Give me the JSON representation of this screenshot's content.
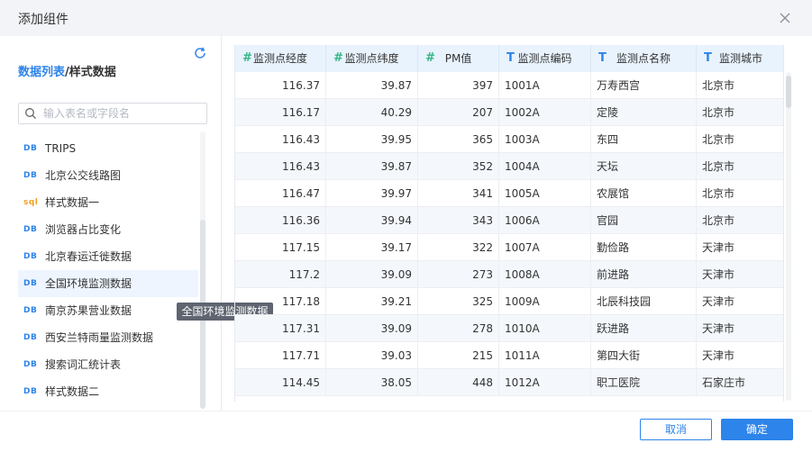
{
  "dialog": {
    "title": "添加组件",
    "close_icon": "close-icon"
  },
  "sidebar": {
    "breadcrumb_link": "数据列表",
    "breadcrumb_sep": "/",
    "breadcrumb_current": "样式数据",
    "refresh_icon": "refresh-icon",
    "search_placeholder": "输入表名或字段名",
    "search_value": "",
    "items": [
      {
        "tag": "DB",
        "label": "TRIPS"
      },
      {
        "tag": "DB",
        "label": "北京公交线路图"
      },
      {
        "tag": "sql",
        "label": "样式数据一"
      },
      {
        "tag": "DB",
        "label": "浏览器占比变化"
      },
      {
        "tag": "DB",
        "label": "北京春运迁徙数据"
      },
      {
        "tag": "DB",
        "label": "全国环境监测数据"
      },
      {
        "tag": "DB",
        "label": "南京苏果营业数据"
      },
      {
        "tag": "DB",
        "label": "西安兰特雨量监测数据"
      },
      {
        "tag": "DB",
        "label": "搜索词汇统计表"
      },
      {
        "tag": "DB",
        "label": "样式数据二"
      }
    ],
    "active_index": 5,
    "tooltip": "全国环境监测数据"
  },
  "table": {
    "columns": [
      {
        "type": "#",
        "label": "监测点经度"
      },
      {
        "type": "#",
        "label": "监测点纬度"
      },
      {
        "type": "#",
        "label": "PM值"
      },
      {
        "type": "T",
        "label": "监测点编码"
      },
      {
        "type": "T",
        "label": "监测点名称"
      },
      {
        "type": "T",
        "label": "监测城市"
      }
    ],
    "rows": [
      [
        "116.37",
        "39.87",
        "397",
        "1001A",
        "万寿西宫",
        "北京市"
      ],
      [
        "116.17",
        "40.29",
        "207",
        "1002A",
        "定陵",
        "北京市"
      ],
      [
        "116.43",
        "39.95",
        "365",
        "1003A",
        "东四",
        "北京市"
      ],
      [
        "116.43",
        "39.87",
        "352",
        "1004A",
        "天坛",
        "北京市"
      ],
      [
        "116.47",
        "39.97",
        "341",
        "1005A",
        "农展馆",
        "北京市"
      ],
      [
        "116.36",
        "39.94",
        "343",
        "1006A",
        "官园",
        "北京市"
      ],
      [
        "117.15",
        "39.17",
        "322",
        "1007A",
        "勤俭路",
        "天津市"
      ],
      [
        "117.2",
        "39.09",
        "273",
        "1008A",
        "前进路",
        "天津市"
      ],
      [
        "117.18",
        "39.21",
        "325",
        "1009A",
        "北辰科技园",
        "天津市"
      ],
      [
        "117.31",
        "39.09",
        "278",
        "1010A",
        "跃进路",
        "天津市"
      ],
      [
        "117.71",
        "39.03",
        "215",
        "1011A",
        "第四大街",
        "天津市"
      ],
      [
        "114.45",
        "38.05",
        "448",
        "1012A",
        "职工医院",
        "石家庄市"
      ]
    ]
  },
  "footer": {
    "cancel_label": "取消",
    "ok_label": "确定"
  },
  "colors": {
    "accent": "#2d84ea",
    "sql_tag": "#f0a020",
    "number_type": "#35b58a",
    "header_bg": "#e9f3fd",
    "tooltip_bg": "#5e6470"
  }
}
